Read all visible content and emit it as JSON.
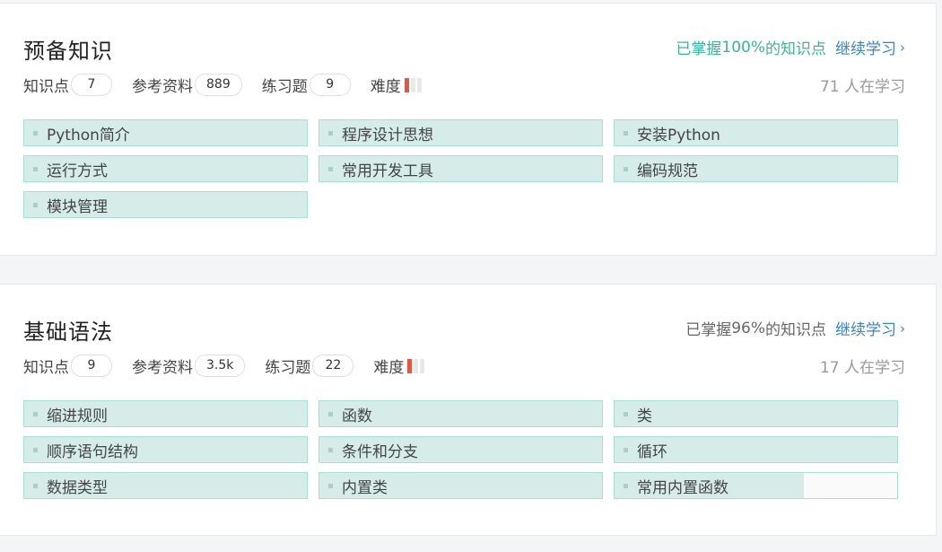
{
  "cards": [
    {
      "title": "预备知识",
      "progress_prefix": "已掌握",
      "progress_pct": "100%",
      "progress_suffix": "的知识点",
      "continue_label": "继续学习",
      "kp_label": "知识点",
      "kp_count": "7",
      "ref_label": "参考资料",
      "ref_count": "889",
      "ex_label": "练习题",
      "ex_count": "9",
      "difficulty_label": "难度",
      "difficulty_level": 1,
      "difficulty_max": 3,
      "learners": "71 人在学习",
      "topics": [
        {
          "label": "Python简介",
          "mastery": 1
        },
        {
          "label": "程序设计思想",
          "mastery": 1
        },
        {
          "label": "安装Python",
          "mastery": 1
        },
        {
          "label": "运行方式",
          "mastery": 1
        },
        {
          "label": "常用开发工具",
          "mastery": 1
        },
        {
          "label": "编码规范",
          "mastery": 1
        },
        {
          "label": "模块管理",
          "mastery": 1
        }
      ]
    },
    {
      "title": "基础语法",
      "progress_prefix": "已掌握",
      "progress_pct": "96%",
      "progress_suffix": "的知识点",
      "continue_label": "继续学习",
      "kp_label": "知识点",
      "kp_count": "9",
      "ref_label": "参考资料",
      "ref_count": "3.5k",
      "ex_label": "练习题",
      "ex_count": "22",
      "difficulty_label": "难度",
      "difficulty_level": 1,
      "difficulty_max": 3,
      "learners": "17 人在学习",
      "topics": [
        {
          "label": "缩进规则",
          "mastery": 1
        },
        {
          "label": "函数",
          "mastery": 1
        },
        {
          "label": "类",
          "mastery": 1
        },
        {
          "label": "顺序语句结构",
          "mastery": 1
        },
        {
          "label": "条件和分支",
          "mastery": 1
        },
        {
          "label": "循环",
          "mastery": 1
        },
        {
          "label": "数据类型",
          "mastery": 1
        },
        {
          "label": "内置类",
          "mastery": 1
        },
        {
          "label": "常用内置函数",
          "mastery": 0.67
        }
      ]
    }
  ],
  "colors": {
    "mastered_text": "#3bb39a",
    "link": "#3a83c4",
    "tag_fill": "#d5ece9",
    "tag_border": "#a9ded6",
    "difficulty_on": "#e8553f",
    "difficulty_off": "#e8e8e8"
  },
  "icons": {
    "continue": "chevron-right-icon",
    "difficulty": "difficulty-bars-icon",
    "tag_marker": "square-bullet-icon"
  }
}
